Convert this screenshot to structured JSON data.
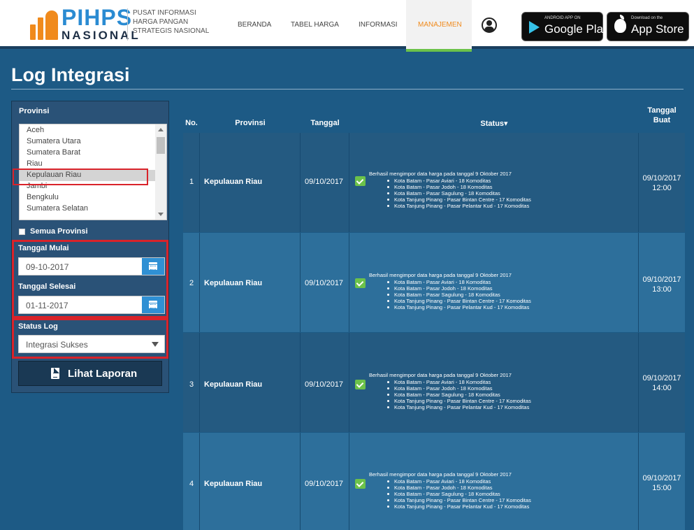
{
  "header": {
    "logo_text": "PIHPS",
    "logo_sub": "NASIONAL",
    "logo_desc": [
      "PUSAT INFORMASI",
      "HARGA PANGAN",
      "STRATEGIS NASIONAL"
    ],
    "nav": [
      "BERANDA",
      "TABEL HARGA",
      "INFORMASI",
      "MANAJEMEN"
    ],
    "active_nav": "MANAJEMEN",
    "google_play": {
      "small": "ANDROID APP ON",
      "big": "Google Play"
    },
    "app_store": {
      "small": "Download on the",
      "big": "App Store"
    }
  },
  "page": {
    "title": "Log Integrasi"
  },
  "filters": {
    "provinsi_label": "Provinsi",
    "provinces": [
      "Aceh",
      "Sumatera Utara",
      "Sumatera Barat",
      "Riau",
      "Kepulauan Riau",
      "Jambi",
      "Bengkulu",
      "Sumatera Selatan"
    ],
    "selected_province": "Kepulauan Riau",
    "all_provinces_label": "Semua Provinsi",
    "tanggal_mulai_label": "Tanggal Mulai",
    "tanggal_mulai": "09-10-2017",
    "tanggal_selesai_label": "Tanggal Selesai",
    "tanggal_selesai": "01-11-2017",
    "status_log_label": "Status Log",
    "status_log": "Integrasi Sukses",
    "report_button": "Lihat Laporan"
  },
  "table": {
    "headers": {
      "no": "No.",
      "provinsi": "Provinsi",
      "tanggal": "Tanggal",
      "status": "Status▾",
      "tanggal_buat_1": "Tanggal",
      "tanggal_buat_2": "Buat"
    },
    "rows": [
      {
        "no": "1",
        "provinsi": "Kepulauan Riau",
        "tanggal": "09/10/2017",
        "status_head": "Berhasil mengimpor data harga pada tanggal 9 Oktober 2017",
        "status_items": [
          "Kota Batam - Pasar Aviari - 18 Komoditas",
          "Kota Batam - Pasar Jodoh - 18 Komoditas",
          "Kota Batam - Pasar Sagulung - 18 Komoditas",
          "Kota Tanjung Pinang - Pasar Bintan Centre - 17 Komoditas",
          "Kota Tanjung Pinang - Pasar Pelantar Kud - 17 Komoditas"
        ],
        "buat_date": "09/10/2017",
        "buat_time": "12:00"
      },
      {
        "no": "2",
        "provinsi": "Kepulauan Riau",
        "tanggal": "09/10/2017",
        "status_head": "Berhasil mengimpor data harga pada tanggal 9 Oktober 2017",
        "status_items": [
          "Kota Batam - Pasar Aviari - 18 Komoditas",
          "Kota Batam - Pasar Jodoh - 18 Komoditas",
          "Kota Batam - Pasar Sagulung - 18 Komoditas",
          "Kota Tanjung Pinang - Pasar Bintan Centre - 17 Komoditas",
          "Kota Tanjung Pinang - Pasar Pelantar Kud - 17 Komoditas"
        ],
        "buat_date": "09/10/2017",
        "buat_time": "13:00"
      },
      {
        "no": "3",
        "provinsi": "Kepulauan Riau",
        "tanggal": "09/10/2017",
        "status_head": "Berhasil mengimpor data harga pada tanggal 9 Oktober 2017",
        "status_items": [
          "Kota Batam - Pasar Aviari - 18 Komoditas",
          "Kota Batam - Pasar Jodoh - 18 Komoditas",
          "Kota Batam - Pasar Sagulung - 18 Komoditas",
          "Kota Tanjung Pinang - Pasar Bintan Centre - 17 Komoditas",
          "Kota Tanjung Pinang - Pasar Pelantar Kud - 17 Komoditas"
        ],
        "buat_date": "09/10/2017",
        "buat_time": "14:00"
      },
      {
        "no": "4",
        "provinsi": "Kepulauan Riau",
        "tanggal": "09/10/2017",
        "status_head": "Berhasil mengimpor data harga pada tanggal 9 Oktober 2017",
        "status_items": [
          "Kota Batam - Pasar Aviari - 18 Komoditas",
          "Kota Batam - Pasar Jodoh - 18 Komoditas",
          "Kota Batam - Pasar Sagulung - 18 Komoditas",
          "Kota Tanjung Pinang - Pasar Bintan Centre - 17 Komoditas",
          "Kota Tanjung Pinang - Pasar Pelantar Kud - 17 Komoditas"
        ],
        "buat_date": "09/10/2017",
        "buat_time": "15:00"
      }
    ]
  }
}
